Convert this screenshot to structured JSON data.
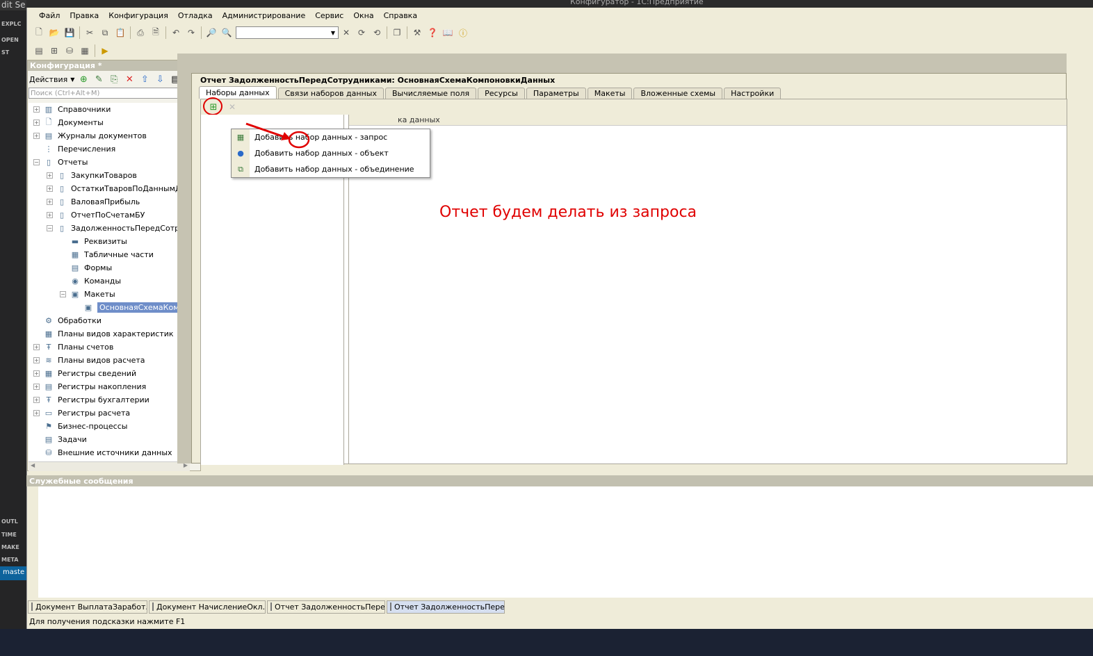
{
  "bg_editor": {
    "menu_text": "dit   Se",
    "sections": [
      "EXPLC",
      "OPEN",
      "ST",
      "OUTL",
      "TIME",
      "MAKE",
      "META"
    ],
    "status": "maste"
  },
  "window_title": "Конфигуратор - 1С:Предприятие",
  "menu": [
    "Файл",
    "Правка",
    "Конфигурация",
    "Отладка",
    "Администрирование",
    "Сервис",
    "Окна",
    "Справка"
  ],
  "config_panel": {
    "title": "Конфигурация *",
    "pin": "ᵖ",
    "actions_label": "Действия",
    "search_placeholder": "Поиск (Ctrl+Alt+M)",
    "tree": [
      {
        "label": "Справочники",
        "level": 0,
        "expand": "+",
        "icon": "grid-icon"
      },
      {
        "label": "Документы",
        "level": 0,
        "expand": "+",
        "icon": "document-icon"
      },
      {
        "label": "Журналы документов",
        "level": 0,
        "expand": "+",
        "icon": "journal-icon"
      },
      {
        "label": "Перечисления",
        "level": 0,
        "expand": "",
        "icon": "enum-icon"
      },
      {
        "label": "Отчеты",
        "level": 0,
        "expand": "-",
        "icon": "report-icon"
      },
      {
        "label": "ЗакупкиТоваров",
        "level": 1,
        "expand": "+",
        "icon": "report-icon"
      },
      {
        "label": "ОстаткиТваровПоДаннымДокуме",
        "level": 1,
        "expand": "+",
        "icon": "report-icon"
      },
      {
        "label": "ВаловаяПрибыль",
        "level": 1,
        "expand": "+",
        "icon": "report-icon"
      },
      {
        "label": "ОтчетПоСчетамБУ",
        "level": 1,
        "expand": "+",
        "icon": "report-icon"
      },
      {
        "label": "ЗадолженностьПередСотрудника",
        "level": 1,
        "expand": "-",
        "icon": "report-icon"
      },
      {
        "label": "Реквизиты",
        "level": 2,
        "expand": "",
        "icon": "attribute-icon"
      },
      {
        "label": "Табличные части",
        "level": 2,
        "expand": "",
        "icon": "table-icon"
      },
      {
        "label": "Формы",
        "level": 2,
        "expand": "",
        "icon": "form-icon"
      },
      {
        "label": "Команды",
        "level": 2,
        "expand": "",
        "icon": "command-icon"
      },
      {
        "label": "Макеты",
        "level": 2,
        "expand": "-",
        "icon": "template-icon"
      },
      {
        "label": "ОсновнаяСхемаКомпоновк",
        "level": 3,
        "expand": "",
        "icon": "schema-icon",
        "selected": true
      },
      {
        "label": "Обработки",
        "level": 0,
        "expand": "",
        "icon": "processing-icon"
      },
      {
        "label": "Планы видов характеристик",
        "level": 0,
        "expand": "",
        "icon": "chart-types-icon"
      },
      {
        "label": "Планы счетов",
        "level": 0,
        "expand": "+",
        "icon": "accounts-icon"
      },
      {
        "label": "Планы видов расчета",
        "level": 0,
        "expand": "+",
        "icon": "calc-types-icon"
      },
      {
        "label": "Регистры сведений",
        "level": 0,
        "expand": "+",
        "icon": "info-register-icon"
      },
      {
        "label": "Регистры накопления",
        "level": 0,
        "expand": "+",
        "icon": "accum-register-icon"
      },
      {
        "label": "Регистры бухгалтерии",
        "level": 0,
        "expand": "+",
        "icon": "acc-register-icon"
      },
      {
        "label": "Регистры расчета",
        "level": 0,
        "expand": "+",
        "icon": "calc-register-icon"
      },
      {
        "label": "Бизнес-процессы",
        "level": 0,
        "expand": "",
        "icon": "business-process-icon"
      },
      {
        "label": "Задачи",
        "level": 0,
        "expand": "",
        "icon": "task-icon"
      },
      {
        "label": "Внешние источники данных",
        "level": 0,
        "expand": "",
        "icon": "external-source-icon"
      }
    ]
  },
  "report_window": {
    "title": "Отчет ЗадолженностьПередСотрудниками: ОсновнаяСхемаКомпоновкиДанных",
    "tabs": [
      "Наборы данных",
      "Связи наборов данных",
      "Вычисляемые поля",
      "Ресурсы",
      "Параметры",
      "Макеты",
      "Вложенные схемы",
      "Настройки"
    ],
    "active_tab": 0,
    "right_header_fragment": "ка данных"
  },
  "popup_menu": [
    {
      "label": "Добавить набор данных - запрос",
      "icon": "query-icon"
    },
    {
      "label": "Добавить набор данных - объект",
      "icon": "object-icon"
    },
    {
      "label": "Добавить набор данных - объединение",
      "icon": "union-icon"
    }
  ],
  "annotation": "Отчет будем делать из запроса",
  "messages_title": "Служебные сообщения",
  "taskbar": [
    "Документ ВыплатаЗаработ...",
    "Документ НачислениеОкл...",
    "Отчет ЗадолженностьПере...",
    "Отчет ЗадолженностьПере..."
  ],
  "status_text": "Для получения подсказки нажмите F1",
  "colors": {
    "annotation": "#e00000",
    "selection": "#6f8ec9",
    "chrome": "#efecd9"
  }
}
